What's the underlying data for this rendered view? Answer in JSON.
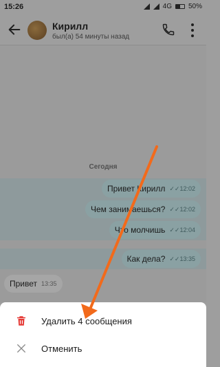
{
  "status_bar": {
    "time": "15:26",
    "network": "4G",
    "battery": "50%"
  },
  "header": {
    "contact_name": "Кирилл",
    "last_seen": "был(а) 54 минуты назад"
  },
  "chat": {
    "date_separator": "Сегодня",
    "messages": [
      {
        "direction": "out",
        "text": "Привет Кирилл",
        "time": "12:02",
        "status": "✓✓"
      },
      {
        "direction": "out",
        "text": "Чем занимаешься?",
        "time": "12:02",
        "status": "✓✓"
      },
      {
        "direction": "out",
        "text": "Что молчишь",
        "time": "12:04",
        "status": "✓✓"
      },
      {
        "direction": "out",
        "text": "Как дела?",
        "time": "13:35",
        "status": "✓✓"
      },
      {
        "direction": "in",
        "text": "Привет",
        "time": "13:35"
      }
    ]
  },
  "sheet": {
    "delete_label": "Удалить 4 сообщения",
    "cancel_label": "Отменить"
  },
  "colors": {
    "delete_icon": "#e53935",
    "annotation_arrow": "#f26a1b"
  }
}
